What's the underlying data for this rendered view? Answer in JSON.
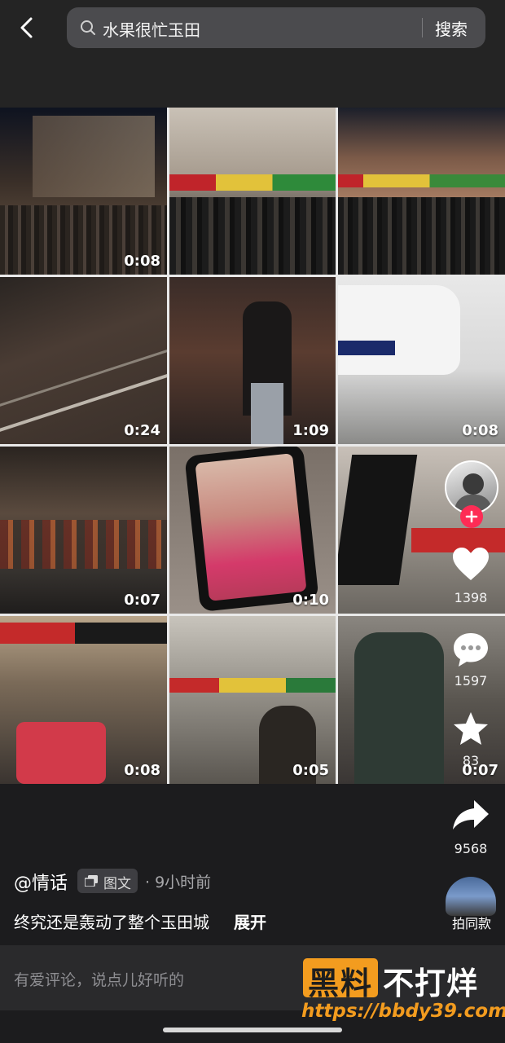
{
  "header": {
    "back_icon": "chevron-left-icon",
    "search_query": "水果很忙玉田",
    "search_button": "搜索"
  },
  "grid": {
    "tiles": [
      {
        "duration": "0:08"
      },
      {
        "duration": ""
      },
      {
        "duration": ""
      },
      {
        "duration": "0:24"
      },
      {
        "duration": "1:09"
      },
      {
        "duration": "0:08"
      },
      {
        "duration": "0:07"
      },
      {
        "duration": "0:10"
      },
      {
        "duration": ""
      },
      {
        "duration": "0:08"
      },
      {
        "duration": "0:05"
      },
      {
        "duration": "0:07"
      }
    ]
  },
  "post": {
    "author": "@情话",
    "tag_label": "图文",
    "time": "· 9小时前",
    "caption": "终究还是轰动了整个玉田城",
    "expand_label": "展开"
  },
  "actions": {
    "likes": "1398",
    "comments": "1597",
    "favorites": "83",
    "shares": "9568",
    "same_style_label": "拍同款"
  },
  "comment": {
    "placeholder": "有爱评论，说点儿好听的"
  },
  "watermark": {
    "brand": "黑料",
    "slogan": "不打烊",
    "url": "https://bbdy39.com"
  },
  "colors": {
    "accent_red": "#fe2c55",
    "watermark_orange": "#f39c1f"
  }
}
